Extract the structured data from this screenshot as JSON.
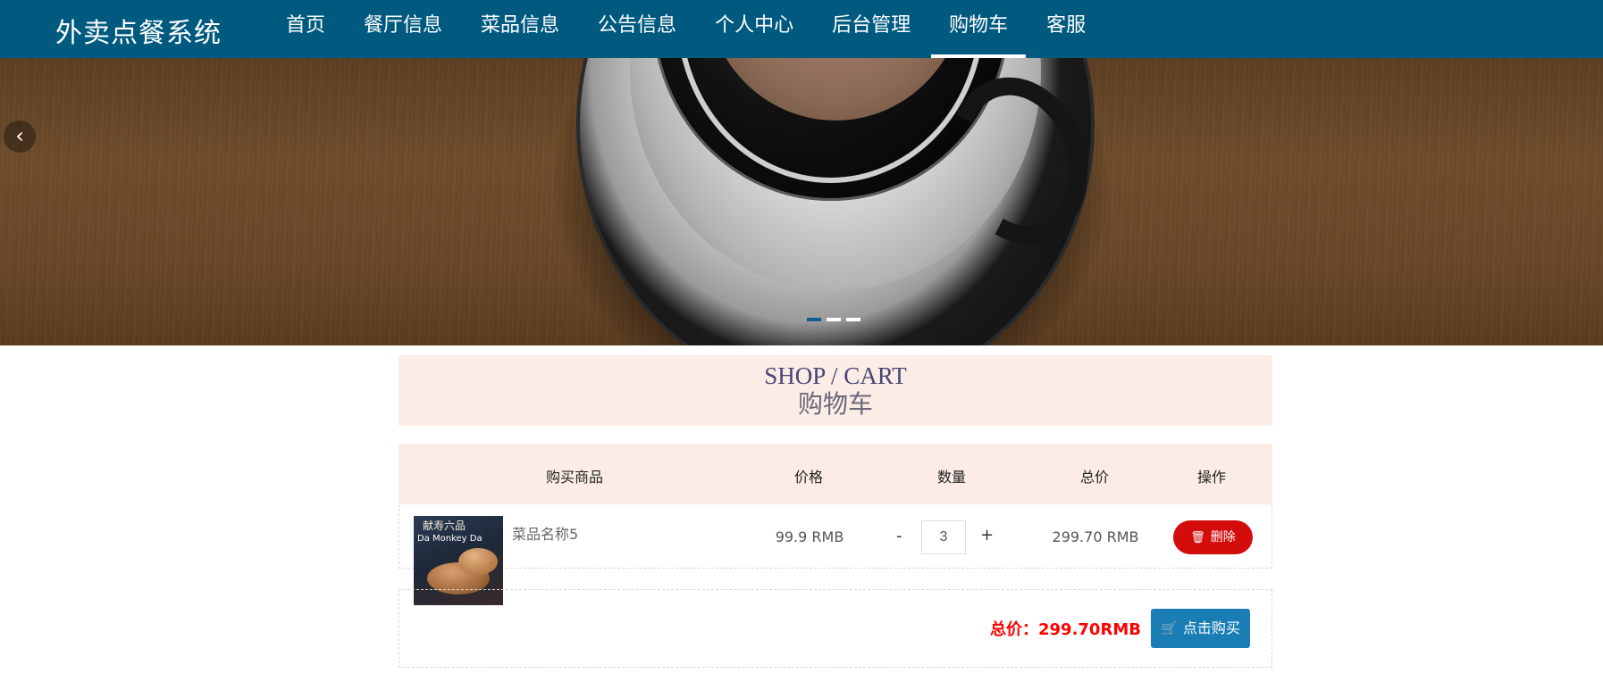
{
  "app": {
    "brand": "外卖点餐系统"
  },
  "nav": {
    "items": [
      {
        "label": "首页"
      },
      {
        "label": "餐厅信息"
      },
      {
        "label": "菜品信息"
      },
      {
        "label": "公告信息"
      },
      {
        "label": "个人中心"
      },
      {
        "label": "后台管理"
      },
      {
        "label": "购物车"
      },
      {
        "label": "客服"
      }
    ],
    "active": "购物车"
  },
  "hero": {
    "prev_icon": "chevron-left-icon",
    "slide_count": 3,
    "active_slide": 1
  },
  "page": {
    "title_en": "SHOP / CART",
    "title_cn": "购物车"
  },
  "cart": {
    "columns": [
      "购买商品",
      "价格",
      "数量",
      "总价",
      "操作"
    ],
    "items": [
      {
        "name": "菜品名称5",
        "image_text_1": "献寿六品",
        "image_text_2": "Da Monkey Da",
        "price": "99.9 RMB",
        "quantity": "3",
        "qty_minus": "-",
        "qty_plus": "+",
        "subtotal": "299.70 RMB",
        "delete_label": "删除"
      }
    ],
    "total_label": "总价：299.70RMB",
    "buy_label": "点击购买"
  },
  "colors": {
    "nav_bg": "#005a80",
    "title_bg": "#fbede5",
    "delete": "#d30c0c",
    "buy": "#1a7db6",
    "total": "#ff0000"
  }
}
